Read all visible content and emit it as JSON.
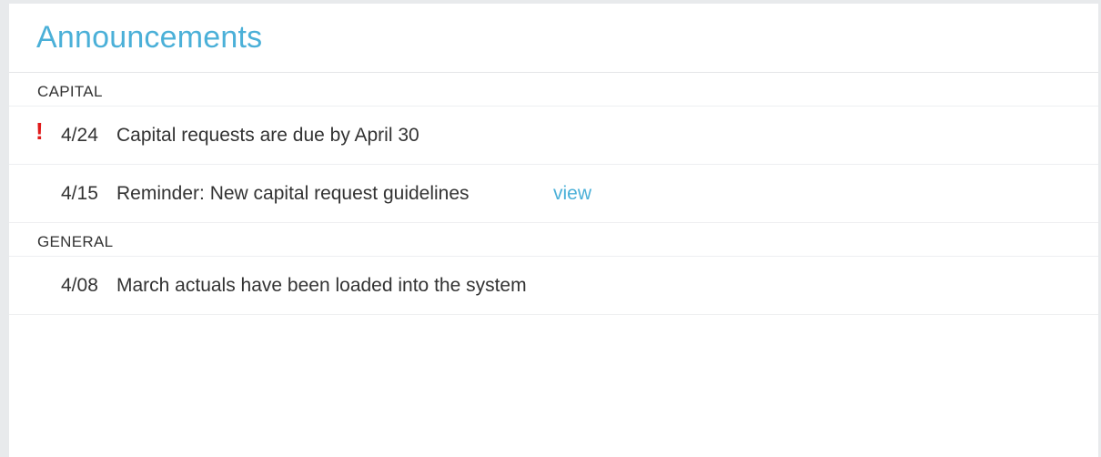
{
  "panel": {
    "title": "Announcements"
  },
  "sections": [
    {
      "label": "CAPITAL",
      "items": [
        {
          "alert": "!",
          "date": "4/24",
          "text": "Capital requests are due by April 30"
        },
        {
          "date": "4/15",
          "text": "Reminder: New capital request guidelines",
          "link": "view"
        }
      ]
    },
    {
      "label": "GENERAL",
      "items": [
        {
          "date": "4/08",
          "text": "March actuals have been loaded into the system"
        }
      ]
    }
  ],
  "colors": {
    "accent": "#4bb0d8",
    "alert": "#e01a1a",
    "text": "#333333"
  }
}
